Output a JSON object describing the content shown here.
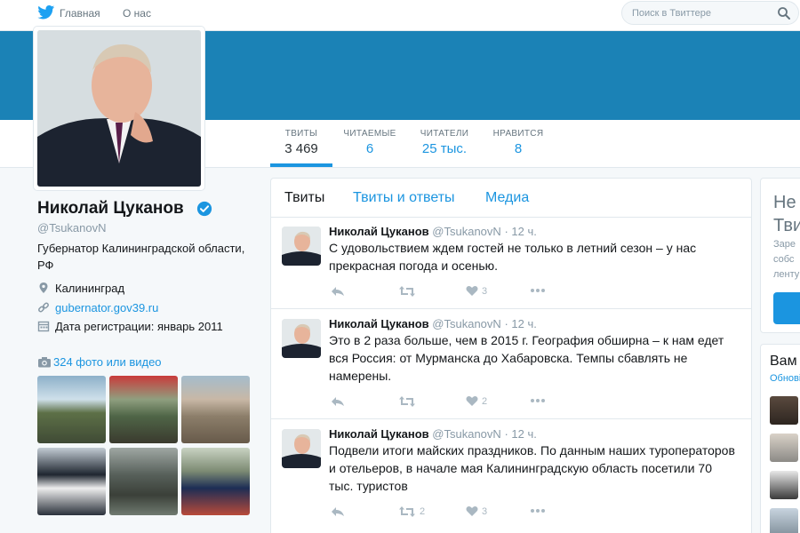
{
  "nav": {
    "home_label": "Главная",
    "about_label": "О нас",
    "search_placeholder": "Поиск в Твиттере"
  },
  "colors": {
    "accent": "#1b95e0",
    "banner": "#1b82b6"
  },
  "stats": [
    {
      "label": "ТВИТЫ",
      "value": "3 469"
    },
    {
      "label": "ЧИТАЕМЫЕ",
      "value": "6"
    },
    {
      "label": "ЧИТАТЕЛИ",
      "value": "25 тыс."
    },
    {
      "label": "НРАВИТСЯ",
      "value": "8"
    }
  ],
  "profile": {
    "name": "Николай Цуканов",
    "handle": "@TsukanovN",
    "bio": "Губернатор Калининградской области, РФ",
    "location": "Калининград",
    "website": "gubernator.gov39.ru",
    "joined": "Дата регистрации: январь 2011",
    "photos_label": "324 фото или видео"
  },
  "tabs": [
    "Твиты",
    "Твиты и ответы",
    "Медиа"
  ],
  "tweets": [
    {
      "name": "Николай Цуканов",
      "handle": "@TsukanovN",
      "time": "· 12 ч.",
      "text": "С удовольствием ждем гостей не только в летний сезон – у нас прекрасная погода и осенью.",
      "retweets": "",
      "likes": "3"
    },
    {
      "name": "Николай Цуканов",
      "handle": "@TsukanovN",
      "time": "· 12 ч.",
      "text": "Это в 2 раза больше, чем в 2015 г. География обширна – к нам едет вся Россия: от Мурманска до Хабаровска. Темпы сбавлять не намерены.",
      "retweets": "",
      "likes": "2"
    },
    {
      "name": "Николай Цуканов",
      "handle": "@TsukanovN",
      "time": "· 12 ч.",
      "text": "Подвели итоги майских праздников. По данным наших туроператоров и отельеров, в начале мая Калининградскую область посетили 70 тыс. туристов",
      "retweets": "2",
      "likes": "3"
    }
  ],
  "sidebar": {
    "signup_title": "Не Тви",
    "signup_text": "Заре собс ленту",
    "suggest_title": "Вам",
    "suggest_link": "Обнові"
  }
}
